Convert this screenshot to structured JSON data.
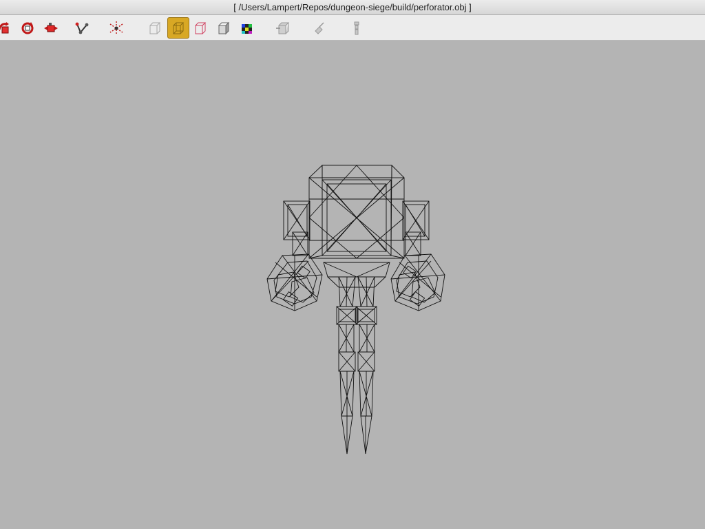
{
  "window": {
    "title": "[ /Users/Lampert/Repos/dungeon-siege/build/perforator.obj ]"
  },
  "toolbar": {
    "buttons": [
      {
        "name": "rotate-tool-icon",
        "active": false
      },
      {
        "name": "spin-tool-icon",
        "active": false
      },
      {
        "name": "move-tool-icon",
        "active": false
      },
      {
        "name": "joint-tool-icon",
        "active": false
      },
      {
        "name": "axes-tool-icon",
        "active": false
      },
      {
        "name": "points-view-icon",
        "active": false
      },
      {
        "name": "wireframe-view-icon",
        "active": true
      },
      {
        "name": "hidden-line-view-icon",
        "active": false
      },
      {
        "name": "shaded-view-icon",
        "active": false
      },
      {
        "name": "textured-view-icon",
        "active": false
      },
      {
        "name": "bounding-box-icon",
        "active": false
      },
      {
        "name": "normals-icon",
        "active": false
      },
      {
        "name": "skeleton-icon",
        "active": false
      }
    ]
  },
  "viewport": {
    "background_color": "#b4b4b4",
    "wire_color": "#111111",
    "model": "perforator.obj"
  }
}
